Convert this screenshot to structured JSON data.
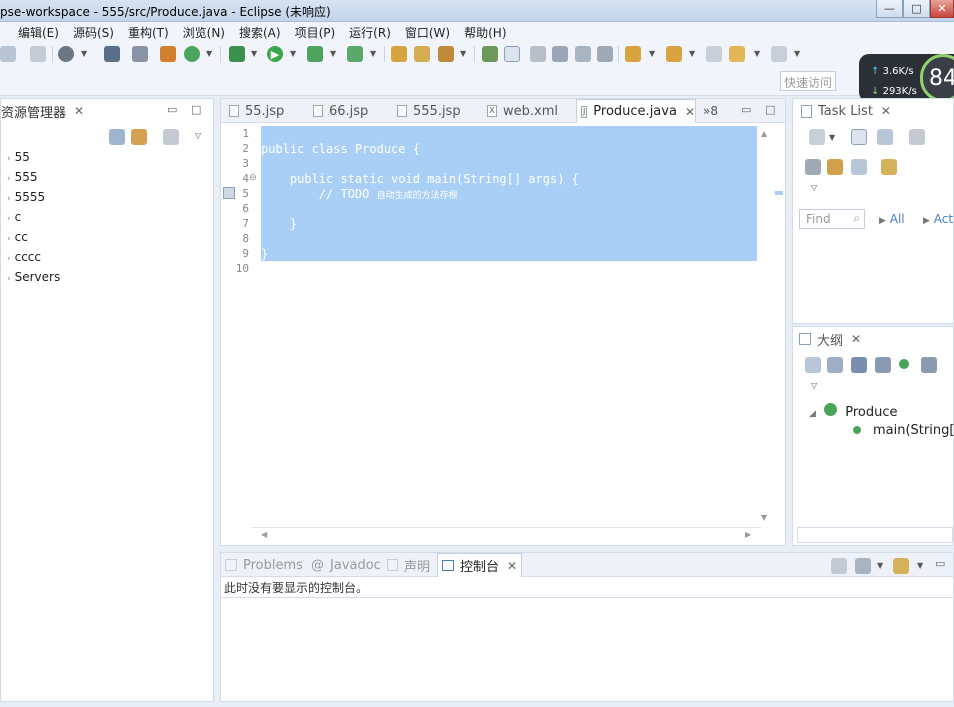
{
  "window": {
    "title": "pse-workspace - 555/src/Produce.java - Eclipse (未响应)",
    "min_label": "—",
    "max_label": "□",
    "close_label": "✕"
  },
  "menu": [
    "编辑(E)",
    "源码(S)",
    "重构(T)",
    "浏览(N)",
    "搜索(A)",
    "项目(P)",
    "运行(R)",
    "窗口(W)",
    "帮助(H)"
  ],
  "quick_access": "快速访问",
  "net": {
    "up": "3.6K/s",
    "down": "293K/s",
    "gauge": "84"
  },
  "explorer": {
    "title": "资源管理器",
    "items": [
      "55",
      "555",
      "5555",
      "c",
      "cc",
      "cccc",
      "Servers"
    ]
  },
  "editor": {
    "tabs": [
      {
        "label": "55.jsp",
        "icon": "jsp-file-icon"
      },
      {
        "label": "66.jsp",
        "icon": "jsp-file-icon"
      },
      {
        "label": "555.jsp",
        "icon": "jsp-file-icon"
      },
      {
        "label": "web.xml",
        "icon": "xml-file-icon"
      },
      {
        "label": "Produce.java",
        "icon": "java-file-icon",
        "active": true
      }
    ],
    "overflow": "»8",
    "line_numbers": [
      "1",
      "2",
      "3",
      "4",
      "5",
      "6",
      "7",
      "8",
      "9",
      "10"
    ],
    "code": [
      "",
      "public class Produce {",
      "",
      "    public static void main(String[] args) {",
      "        // TODO ",
      "",
      "    }",
      "",
      "}",
      ""
    ],
    "todo_comment": "自动生成的方法存根"
  },
  "tasklist": {
    "title": "Task List",
    "find_placeholder": "Find",
    "all_label": "All",
    "acti_label": "Acti"
  },
  "outline": {
    "title": "大纲",
    "class_name": "Produce",
    "method": "main(String[])"
  },
  "console": {
    "tabs": [
      "Problems",
      "Javadoc",
      "声明",
      "控制台"
    ],
    "message": "此时没有要显示的控制台。"
  }
}
